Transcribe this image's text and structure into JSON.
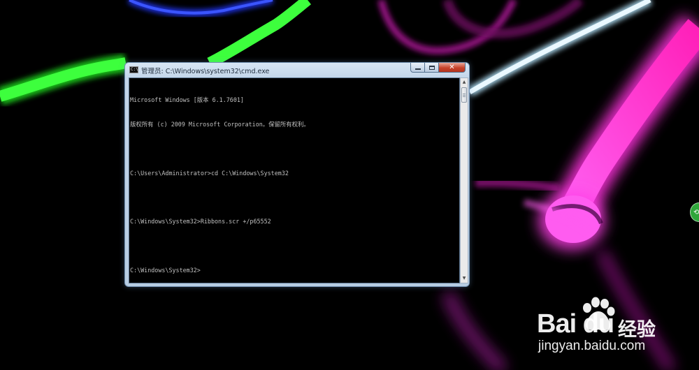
{
  "window": {
    "title": "管理员: C:\\Windows\\system32\\cmd.exe",
    "app_icon_text": "C:\\",
    "controls": {
      "close_label": "✕"
    }
  },
  "console": {
    "lines": [
      "Microsoft Windows [版本 6.1.7601]",
      "版权所有 (c) 2009 Microsoft Corporation。保留所有权利。",
      "",
      "C:\\Users\\Administrator>cd C:\\Windows\\System32",
      "",
      "C:\\Windows\\System32>Ribbons.scr +/p65552",
      "",
      "C:\\Windows\\System32>"
    ]
  },
  "scrollbar": {
    "up_glyph": "▲",
    "down_glyph": "▼"
  },
  "side_button": {
    "icon": "share-icon",
    "glyph": "⟲"
  },
  "watermark": {
    "brand": "Bai du",
    "product": "经验",
    "url": "jingyan.baidu.com"
  },
  "colors": {
    "console_text": "#c0c0c0",
    "console_bg": "#000000",
    "ribbon_green": "#2cf02c",
    "ribbon_magenta": "#ff30e0",
    "ribbon_blue": "#2a3cff",
    "ribbon_cyan": "#bfeaff"
  }
}
